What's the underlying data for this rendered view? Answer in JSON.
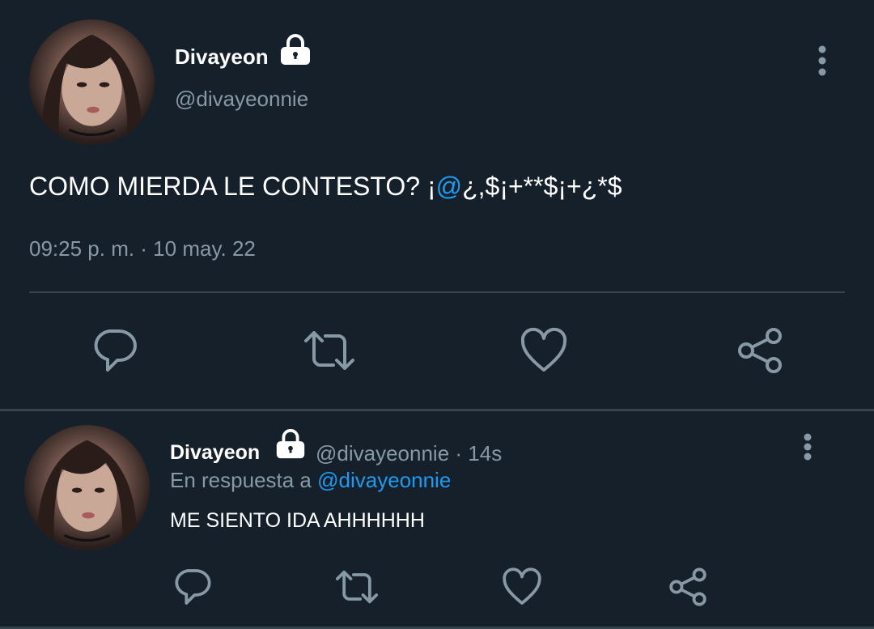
{
  "main_tweet": {
    "display_name": "Divayeon",
    "handle": "@divayeonnie",
    "text_prefix": "COMO MIERDA LE CONTESTO? ¡",
    "text_mention": "@",
    "text_suffix": "¿,$¡+**$¡+¿*$",
    "timestamp": "09:25 p. m. · 10 may. 22"
  },
  "reply": {
    "display_name": "Divayeon",
    "handle_time": "@divayeonnie · 14s",
    "in_reply_prefix": "En respuesta a ",
    "in_reply_mention": "@divayeonnie",
    "text": "ME SIENTO IDA AHHHHHH"
  },
  "icons": [
    "lock-icon",
    "more-vertical-icon",
    "reply-icon",
    "retweet-icon",
    "like-icon",
    "share-icon"
  ],
  "colors": {
    "background": "#15202b",
    "secondary_text": "#8899a6",
    "accent": "#1d9bf0",
    "divider": "#38444d"
  }
}
